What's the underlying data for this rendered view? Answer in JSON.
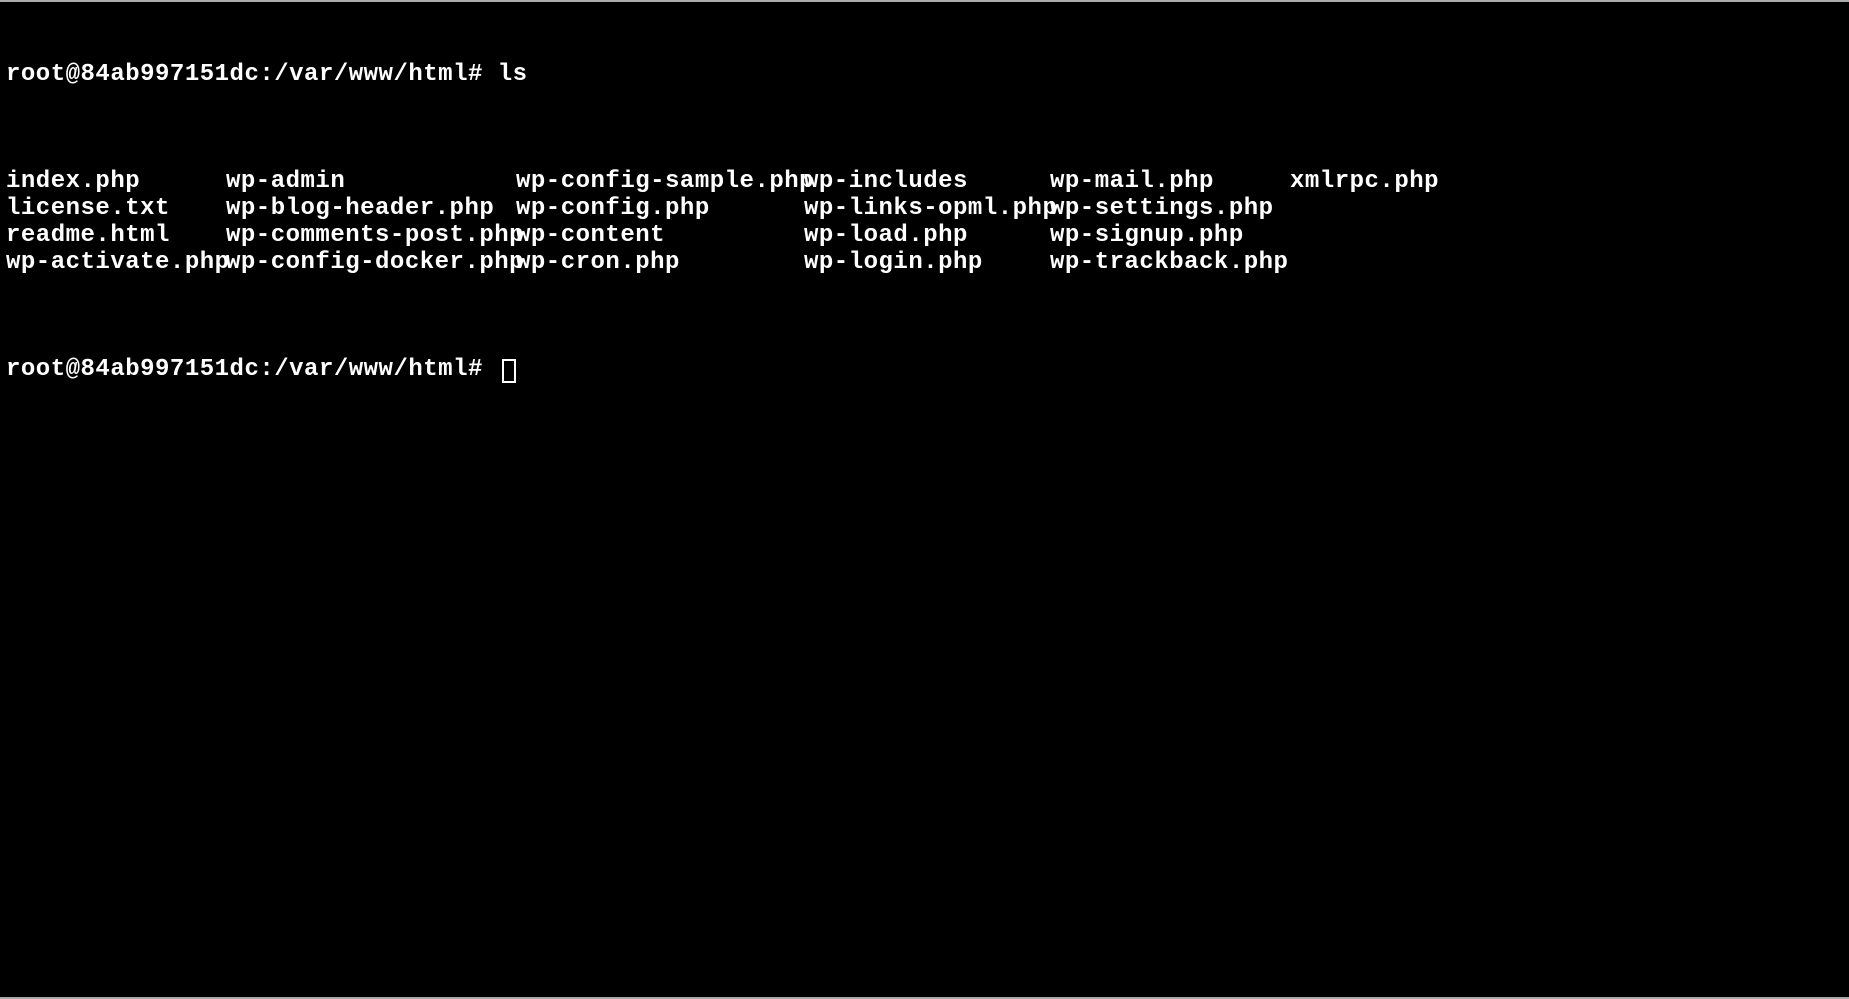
{
  "terminal": {
    "prompt1": "root@84ab997151dc:/var/www/html# ",
    "command1": "ls",
    "ls_output": {
      "col1": [
        "index.php",
        "license.txt",
        "readme.html",
        "wp-activate.php"
      ],
      "col2": [
        "wp-admin",
        "wp-blog-header.php",
        "wp-comments-post.php",
        "wp-config-docker.php"
      ],
      "col3": [
        "wp-config-sample.php",
        "wp-config.php",
        "wp-content",
        "wp-cron.php"
      ],
      "col4": [
        "wp-includes",
        "wp-links-opml.php",
        "wp-load.php",
        "wp-login.php"
      ],
      "col5": [
        "wp-mail.php",
        "wp-settings.php",
        "wp-signup.php",
        "wp-trackback.php"
      ],
      "col6": [
        "xmlrpc.php",
        "",
        "",
        ""
      ]
    },
    "prompt2": "root@84ab997151dc:/var/www/html# "
  }
}
